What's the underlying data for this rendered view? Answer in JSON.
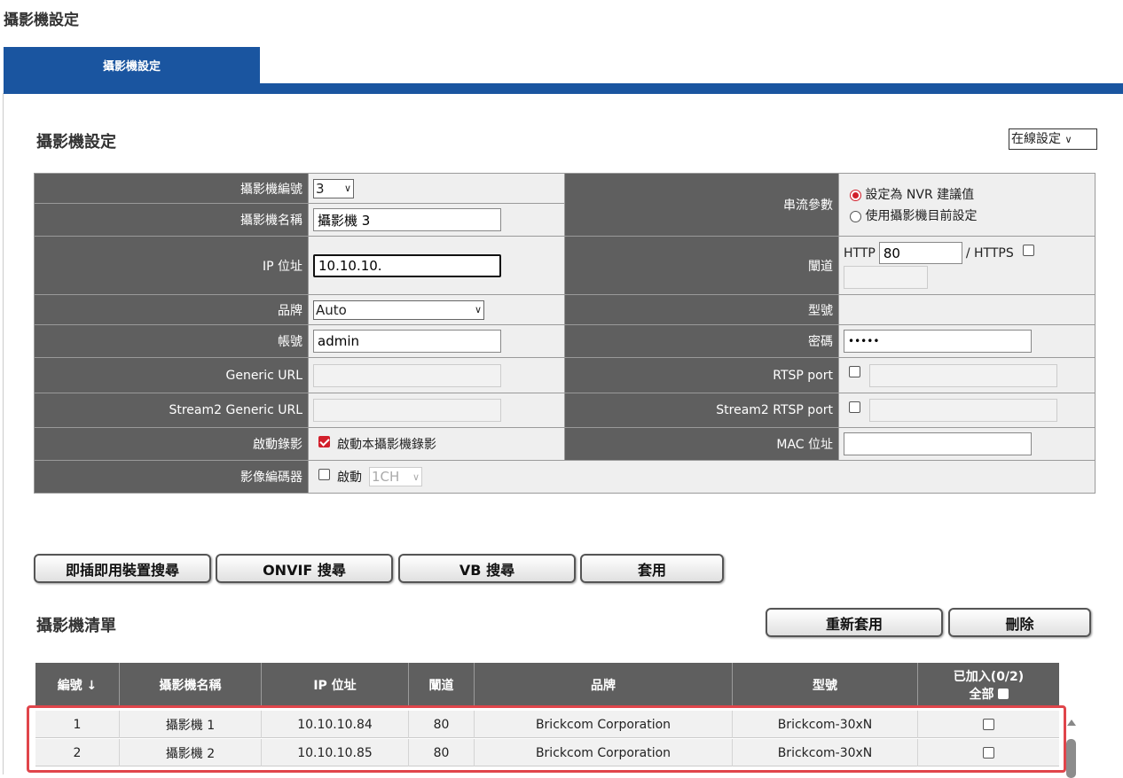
{
  "page": {
    "title": "攝影機設定"
  },
  "tabs": [
    {
      "label": "攝影機設定",
      "active": true
    }
  ],
  "section": {
    "title": "攝影機設定",
    "online_select": "在線設定"
  },
  "form": {
    "camera_number_label": "攝影機編號",
    "camera_number": "3",
    "camera_name_label": "攝影機名稱",
    "camera_name": "攝影機 3",
    "ip_label": "IP 位址",
    "ip": "10.10.10.",
    "brand_label": "品牌",
    "brand": "Auto",
    "account_label": "帳號",
    "account": "admin",
    "generic_url_label": "Generic URL",
    "stream2_url_label": "Stream2 Generic URL",
    "record_label": "啟動錄影",
    "record_text": "啟動本攝影機錄影",
    "encoder_label": "影像編碼器",
    "encoder_text": "啟動",
    "encoder_channel": "1CH",
    "stream_param_label": "串流參數",
    "stream_opt1": "設定為 NVR 建議值",
    "stream_opt2": "使用攝影機目前設定",
    "port_label": "闡道",
    "http_label": "HTTP",
    "http_port": "80",
    "https_label": "/ HTTPS",
    "model_label": "型號",
    "password_label": "密碼",
    "password": "•••••",
    "rtsp_label": "RTSP port",
    "stream2_rtsp_label": "Stream2 RTSP port",
    "mac_label": "MAC 位址"
  },
  "buttons": {
    "plugplay": "即插即用裝置搜尋",
    "onvif": "ONVIF 搜尋",
    "vb": "VB 搜尋",
    "apply": "套用",
    "reapply": "重新套用",
    "delete": "刪除"
  },
  "list": {
    "title": "攝影機清單",
    "headers": {
      "no": "編號 ↓",
      "name": "攝影機名稱",
      "ip": "IP 位址",
      "port": "闡道",
      "brand": "品牌",
      "model": "型號",
      "added": "已加入(0/2)",
      "all": "全部"
    },
    "rows": [
      {
        "no": "1",
        "name": "攝影機 1",
        "ip": "10.10.10.84",
        "port": "80",
        "brand": "Brickcom Corporation",
        "model": "Brickcom-30xN"
      },
      {
        "no": "2",
        "name": "攝影機 2",
        "ip": "10.10.10.85",
        "port": "80",
        "brand": "Brickcom Corporation",
        "model": "Brickcom-30xN"
      }
    ]
  },
  "colors": {
    "accent": "#1a55a0",
    "header_bg": "#5f5f5f",
    "check_red": "#d21f2b",
    "highlight": "#e0454b"
  }
}
